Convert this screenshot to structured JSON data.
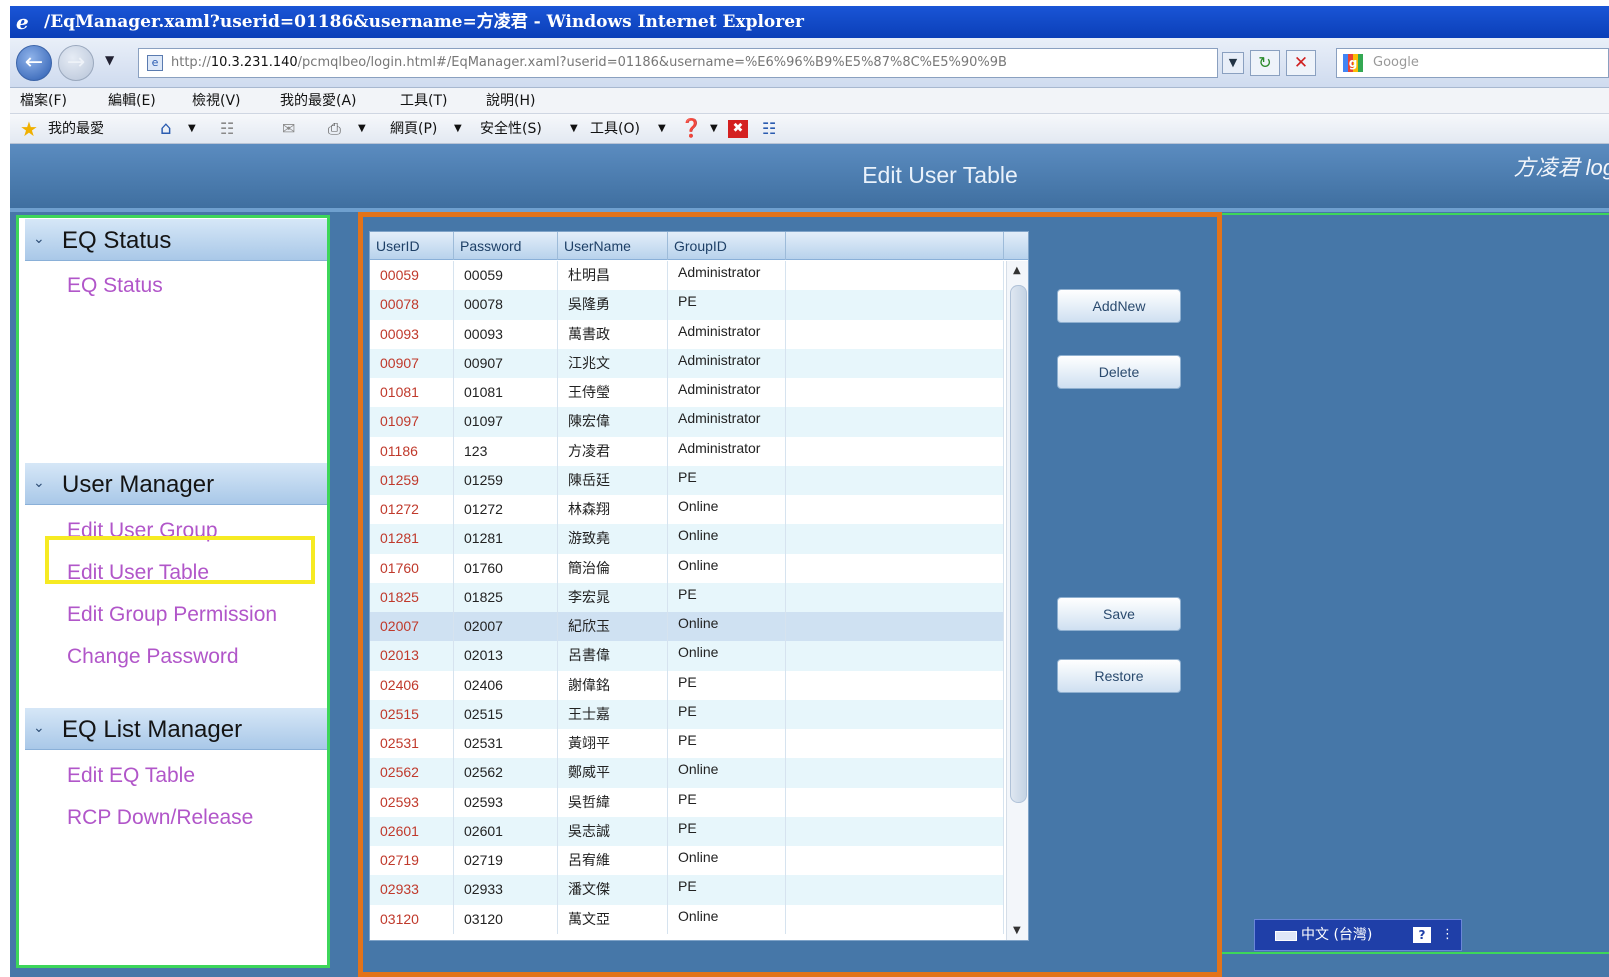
{
  "window": {
    "title": "/EqManager.xaml?userid=01186&username=方凌君 - Windows Internet Explorer"
  },
  "address": {
    "prefix": "http://",
    "host": "10.3.231.140",
    "rest": "/pcmqlbeo/login.html#/EqManager.xaml?userid=01186&username=%E6%96%B9%E5%87%8C%E5%90%9B",
    "search_placeholder": "Google"
  },
  "menu": [
    "檔案(F)",
    "編輯(E)",
    "檢視(V)",
    "我的最愛(A)",
    "工具(T)",
    "說明(H)"
  ],
  "commands": {
    "favorites": "我的最愛",
    "page": "網頁(P)",
    "safety": "安全性(S)",
    "tools": "工具(O)"
  },
  "app": {
    "title": "Edit User Table",
    "user_login": "方凌君 log"
  },
  "nav": {
    "sections": [
      {
        "title": "EQ Status",
        "items": [
          "EQ Status"
        ]
      },
      {
        "title": "User Manager",
        "items": [
          "Edit User Group",
          "Edit User Table",
          "Edit Group  Permission",
          "Change Password"
        ]
      },
      {
        "title": "EQ List Manager",
        "items": [
          "Edit  EQ Table",
          "RCP Down/Release"
        ]
      }
    ],
    "active_item": "Edit User Table"
  },
  "table": {
    "columns": [
      "UserID",
      "Password",
      "UserName",
      "GroupID"
    ],
    "rows": [
      [
        "00059",
        "00059",
        "杜明昌",
        "Administrator"
      ],
      [
        "00078",
        "00078",
        "吳隆勇",
        "PE"
      ],
      [
        "00093",
        "00093",
        "萬書政",
        "Administrator"
      ],
      [
        "00907",
        "00907",
        "江兆文",
        "Administrator"
      ],
      [
        "01081",
        "01081",
        "王侍瑩",
        "Administrator"
      ],
      [
        "01097",
        "01097",
        "陳宏偉",
        "Administrator"
      ],
      [
        "01186",
        "123",
        "方凌君",
        "Administrator"
      ],
      [
        "01259",
        "01259",
        "陳岳廷",
        "PE"
      ],
      [
        "01272",
        "01272",
        "林森翔",
        "Online"
      ],
      [
        "01281",
        "01281",
        "游致堯",
        "Online"
      ],
      [
        "01760",
        "01760",
        "簡治倫",
        "Online"
      ],
      [
        "01825",
        "01825",
        "李宏晁",
        "PE"
      ],
      [
        "02007",
        "02007",
        "紀欣玉",
        "Online"
      ],
      [
        "02013",
        "02013",
        "呂書偉",
        "Online"
      ],
      [
        "02406",
        "02406",
        "謝偉銘",
        "PE"
      ],
      [
        "02515",
        "02515",
        "王士嘉",
        "PE"
      ],
      [
        "02531",
        "02531",
        "黃翊平",
        "PE"
      ],
      [
        "02562",
        "02562",
        "鄭威平",
        "Online"
      ],
      [
        "02593",
        "02593",
        "吳哲緯",
        "PE"
      ],
      [
        "02601",
        "02601",
        "吳志誠",
        "PE"
      ],
      [
        "02719",
        "02719",
        "呂宥維",
        "Online"
      ],
      [
        "02933",
        "02933",
        "潘文傑",
        "PE"
      ],
      [
        "03120",
        "03120",
        "萬文亞",
        "Online"
      ]
    ],
    "selected_row": 12
  },
  "buttons": {
    "addnew": "AddNew",
    "delete": "Delete",
    "save": "Save",
    "restore": "Restore"
  },
  "ime": {
    "label": "中文 (台灣)",
    "help": "?"
  },
  "colors": {
    "app_bg": "#4677a8",
    "panel_border": "#e2731a",
    "nav_border": "#3dd65a",
    "highlight": "#f6ea22",
    "nav_link": "#b156c9",
    "userid_text": "#c0392b"
  }
}
